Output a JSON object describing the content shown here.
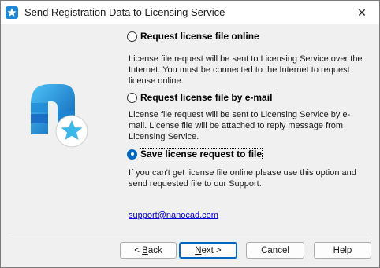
{
  "window": {
    "title": "Send Registration Data to Licensing Service",
    "close_glyph": "✕"
  },
  "options": [
    {
      "label": "Request license file online",
      "checked": false,
      "description": "License file request will be sent to Licensing Service over the Internet. You must be connected to the Internet to request license online."
    },
    {
      "label": "Request license file by e-mail",
      "checked": false,
      "description": "License file request will be sent to Licensing Service by e-mail. License file will be attached to reply message from Licensing Service."
    },
    {
      "label": "Save license request to file",
      "checked": true,
      "description": "If you can't get license file online please use this option and send requested file to our Support."
    }
  ],
  "support_email": "support@nanocad.com",
  "buttons": {
    "back_prefix": "< ",
    "back_accel": "B",
    "back_rest": "ack",
    "next_accel": "N",
    "next_rest": "ext >",
    "cancel": "Cancel",
    "help": "Help"
  },
  "colors": {
    "accent": "#0067c0",
    "logo_blue": "#1e88d6",
    "logo_light": "#4fc3f7",
    "star": "#3bb7e8"
  }
}
